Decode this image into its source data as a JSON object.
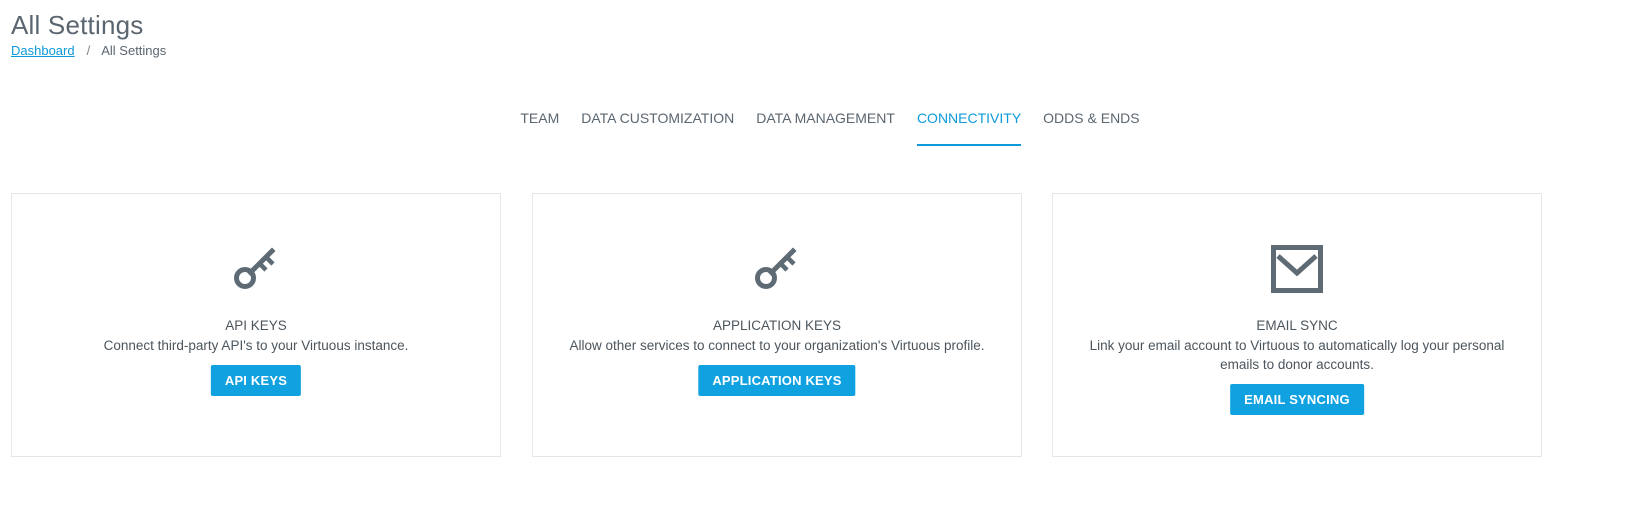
{
  "header": {
    "title": "All Settings",
    "breadcrumb": {
      "link": "Dashboard",
      "separator": "/",
      "current": "All Settings"
    }
  },
  "tabs": [
    {
      "label": "TEAM",
      "active": false
    },
    {
      "label": "DATA CUSTOMIZATION",
      "active": false
    },
    {
      "label": "DATA MANAGEMENT",
      "active": false
    },
    {
      "label": "CONNECTIVITY",
      "active": true
    },
    {
      "label": "ODDS & ENDS",
      "active": false
    }
  ],
  "cards": [
    {
      "icon": "key-icon",
      "title": "API KEYS",
      "description": "Connect third-party API's to your Virtuous instance.",
      "button": "API KEYS"
    },
    {
      "icon": "key-icon",
      "title": "APPLICATION KEYS",
      "description": "Allow other services to connect to your organization's Virtuous profile.",
      "button": "APPLICATION KEYS"
    },
    {
      "icon": "envelope-icon",
      "title": "EMAIL SYNC",
      "description": "Link your email account to Virtuous to automatically log your personal emails to donor accounts.",
      "button": "EMAIL SYNCING"
    }
  ],
  "colors": {
    "accent": "#0e9ad9",
    "button": "#0fa1e0",
    "text": "#5b6670",
    "icon": "#5e6b75",
    "border": "#e4e7ea"
  }
}
